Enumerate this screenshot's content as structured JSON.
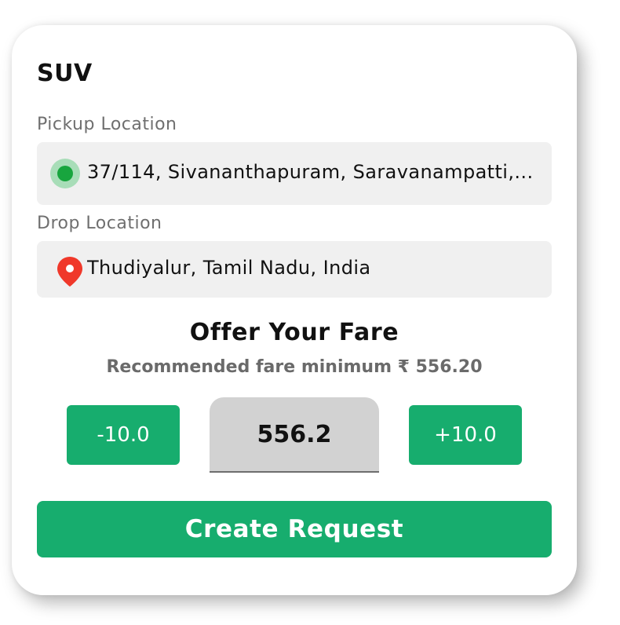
{
  "vehicle": {
    "type": "SUV"
  },
  "pickup": {
    "label": "Pickup Location",
    "value": "37/114, Sivananthapuram, Saravanampatti,...",
    "icon": "pickup-dot-icon"
  },
  "drop": {
    "label": "Drop Location",
    "value": "Thudiyalur, Tamil Nadu, India",
    "icon": "map-pin-icon"
  },
  "fare": {
    "title": "Offer Your Fare",
    "recommended": "Recommended fare minimum ₹ 556.20",
    "decrement_label": "-10.0",
    "increment_label": "+10.0",
    "value": "556.2"
  },
  "actions": {
    "create_label": "Create Request"
  },
  "colors": {
    "accent_green": "#17ad6e",
    "pickup_dot": "#18a53e",
    "pin_red": "#f0382a",
    "field_bg": "#f0f0f0"
  }
}
